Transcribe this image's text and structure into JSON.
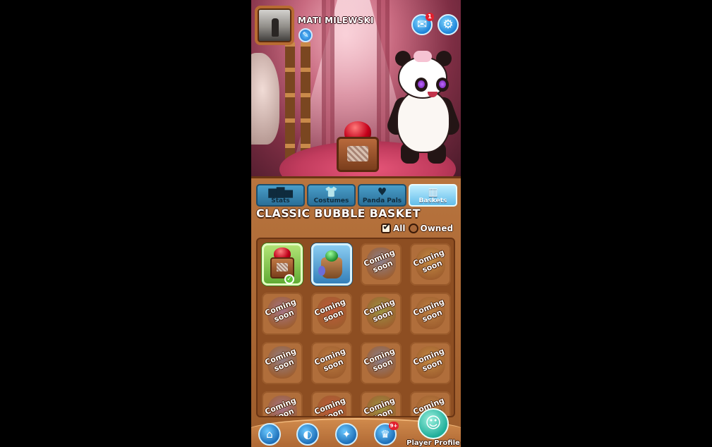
{
  "profile": {
    "name": "MATI MILEWSKI",
    "edit_icon": "pencil-icon",
    "mail_badge": "1",
    "mail_icon": "envelope-icon",
    "settings_icon": "gear-icon"
  },
  "tabs": [
    {
      "label": "Stats",
      "icon": "bar-chart-icon",
      "active": false
    },
    {
      "label": "Costumes",
      "icon": "hanger-icon",
      "active": false
    },
    {
      "label": "Panda Pals",
      "icon": "hearts-icon",
      "active": false
    },
    {
      "label": "Baskets",
      "icon": "basket-icon",
      "active": true
    }
  ],
  "collection": {
    "title": "CLASSIC BUBBLE BASKET",
    "filter_all": "All",
    "filter_owned": "Owned",
    "selected_filter": "All",
    "items": [
      {
        "type": "classic-basket",
        "owned": true,
        "equipped": true
      },
      {
        "type": "tree-basket",
        "owned": true,
        "equipped": false
      },
      {
        "label": "Coming soon"
      },
      {
        "label": "Coming soon"
      },
      {
        "label": "Coming soon"
      },
      {
        "label": "Coming soon"
      },
      {
        "label": "Coming soon"
      },
      {
        "label": "Coming soon"
      },
      {
        "label": "Coming soon"
      },
      {
        "label": "Coming soon"
      },
      {
        "label": "Coming soon"
      },
      {
        "label": "Coming soon"
      },
      {
        "label": "Coming soon"
      },
      {
        "label": "Coming soon"
      },
      {
        "label": "Coming soon"
      },
      {
        "label": "Coming soon"
      }
    ]
  },
  "bottom_nav": {
    "shop_icon": "shop-icon",
    "map_icon": "globe-icon",
    "quests_icon": "scroll-icon",
    "trophy_icon": "trophy-icon",
    "trophy_badge": "9+",
    "profile_label": "Player Profile",
    "profile_icon": "person-icon"
  },
  "colors": {
    "tab_active": "#63bdea",
    "tab_inactive": "#2a6f98",
    "panel_wood": "#9c5b2a",
    "equipped_green": "#5ca830",
    "badge_red": "#e2212e"
  }
}
